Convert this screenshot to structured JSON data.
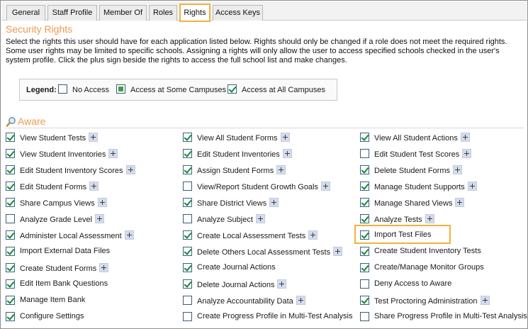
{
  "tabs": [
    {
      "label": "General",
      "active": false
    },
    {
      "label": "Staff Profile",
      "active": false
    },
    {
      "label": "Member Of",
      "active": false
    },
    {
      "label": "Roles",
      "active": false
    },
    {
      "label": "Rights",
      "active": true
    },
    {
      "label": "Access Keys",
      "active": false
    }
  ],
  "section": {
    "title": "Security Rights",
    "description": "Select the rights this user should have for each application listed below. Rights should only be changed if a role does not meet the required rights. Some user rights may be limited to specific schools. Assigning a rights will only allow the user to access specified schools checked in the user's system profile. Click the plus sign beside the rights to access the full school list and make changes."
  },
  "legend": {
    "label": "Legend:",
    "items": [
      {
        "text": "No Access",
        "state": "none"
      },
      {
        "text": "Access at Some Campuses",
        "state": "some"
      },
      {
        "text": "Access at All Campuses",
        "state": "all"
      }
    ]
  },
  "aware": {
    "title": "Aware",
    "icon": "magnifier-icon",
    "columns": [
      [
        {
          "label": "View Student Tests",
          "checked": true,
          "plus": true
        },
        {
          "label": "View Student Inventories",
          "checked": true,
          "plus": true
        },
        {
          "label": "Edit Student Inventory Scores",
          "checked": true,
          "plus": true
        },
        {
          "label": "Edit Student Forms",
          "checked": true,
          "plus": true
        },
        {
          "label": "Share Campus Views",
          "checked": true,
          "plus": true
        },
        {
          "label": "Analyze Grade Level",
          "checked": false,
          "plus": true
        },
        {
          "label": "Administer Local Assessment",
          "checked": true,
          "plus": true
        },
        {
          "label": "Import External Data Files",
          "checked": true,
          "plus": false
        },
        {
          "label": "Create Student Forms",
          "checked": true,
          "plus": true
        },
        {
          "label": "Edit Item Bank Questions",
          "checked": true,
          "plus": false
        },
        {
          "label": "Manage Item Bank",
          "checked": true,
          "plus": false
        },
        {
          "label": "Configure Settings",
          "checked": true,
          "plus": false
        }
      ],
      [
        {
          "label": "View All Student Forms",
          "checked": true,
          "plus": true
        },
        {
          "label": "Edit Student Inventories",
          "checked": true,
          "plus": true
        },
        {
          "label": "Assign Student Forms",
          "checked": true,
          "plus": true
        },
        {
          "label": "View/Report Student Growth Goals",
          "checked": false,
          "plus": true
        },
        {
          "label": "Share District Views",
          "checked": true,
          "plus": true
        },
        {
          "label": "Analyze Subject",
          "checked": false,
          "plus": true
        },
        {
          "label": "Create Local Assessment Tests",
          "checked": true,
          "plus": true
        },
        {
          "label": "Delete Others Local Assessment Tests",
          "checked": true,
          "plus": true
        },
        {
          "label": "Create Journal Actions",
          "checked": true,
          "plus": false
        },
        {
          "label": "Delete Journal Actions",
          "checked": true,
          "plus": true
        },
        {
          "label": "Analyze Accountability Data",
          "checked": false,
          "plus": true
        },
        {
          "label": "Create Progress Profile in Multi-Test Analysis",
          "checked": false,
          "plus": false
        }
      ],
      [
        {
          "label": "View All Student Actions",
          "checked": true,
          "plus": true
        },
        {
          "label": "Edit Student Test Scores",
          "checked": false,
          "plus": true
        },
        {
          "label": "Delete Student Forms",
          "checked": true,
          "plus": true
        },
        {
          "label": "Manage Student Supports",
          "checked": true,
          "plus": true
        },
        {
          "label": "Manage Shared Views",
          "checked": true,
          "plus": true
        },
        {
          "label": "Analyze Tests",
          "checked": true,
          "plus": true
        },
        {
          "label": "Import Test Files",
          "checked": true,
          "plus": false
        },
        {
          "label": "Create Student Inventory Tests",
          "checked": true,
          "plus": false
        },
        {
          "label": "Create/Manage Monitor Groups",
          "checked": true,
          "plus": false
        },
        {
          "label": "Deny Access to Aware",
          "checked": false,
          "plus": false
        },
        {
          "label": "Test Proctoring Administration",
          "checked": true,
          "plus": true
        },
        {
          "label": "Share Progress Profile in Multi-Test Analysis",
          "checked": false,
          "plus": false
        }
      ]
    ]
  },
  "colors": {
    "accent": "#ef9a4a",
    "highlight": "#f2b13c",
    "check": "#0d8a3a"
  }
}
